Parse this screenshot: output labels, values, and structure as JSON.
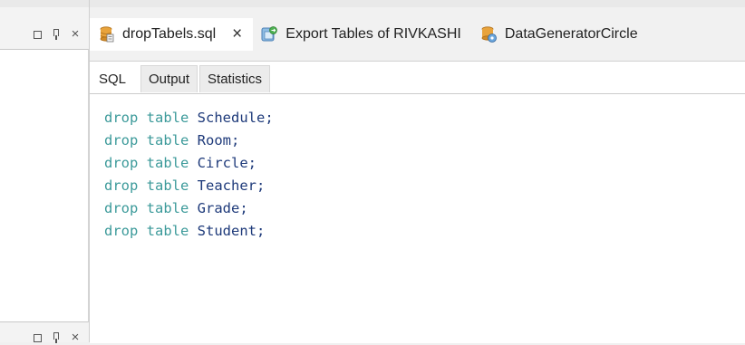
{
  "left_panel": {
    "toolbar_icons": [
      "restore-icon",
      "pin-icon",
      "close-icon"
    ]
  },
  "tabs": [
    {
      "label": "dropTabels.sql",
      "icon": "sql-file-icon",
      "active": true,
      "close_label": "×"
    },
    {
      "label": "Export Tables of RIVKASHI",
      "icon": "export-task-icon",
      "active": false
    },
    {
      "label": "DataGeneratorCircle",
      "icon": "data-generator-icon",
      "active": false
    }
  ],
  "sub_tabs": [
    {
      "label": "SQL"
    },
    {
      "label": "Output"
    },
    {
      "label": "Statistics"
    }
  ],
  "code_lines": [
    {
      "keyword": "drop table",
      "name": "Schedule;"
    },
    {
      "keyword": "drop table",
      "name": "Room;"
    },
    {
      "keyword": "drop table",
      "name": "Circle;"
    },
    {
      "keyword": "drop table",
      "name": "Teacher;"
    },
    {
      "keyword": "drop table",
      "name": "Grade;"
    },
    {
      "keyword": "drop table",
      "name": "Student;"
    }
  ],
  "colors": {
    "keyword": "#3c9a9a",
    "identifier": "#1e3a7a"
  }
}
